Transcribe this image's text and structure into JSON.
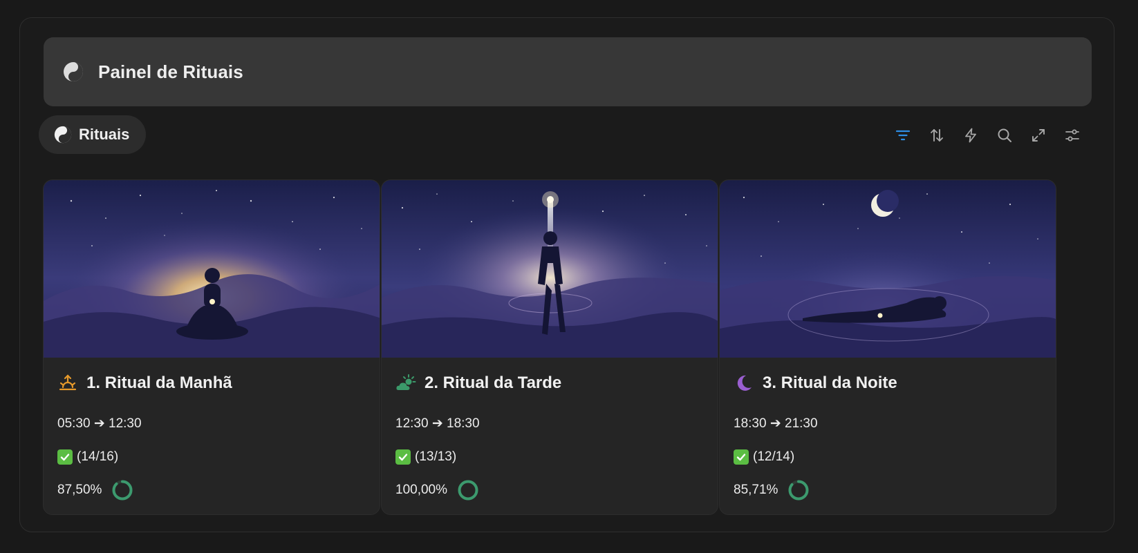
{
  "callout": {
    "icon": "yin-yang-icon",
    "title": "Painel de Rituais"
  },
  "view_tab": {
    "icon": "yin-yang-icon",
    "label": "Rituais"
  },
  "toolbar": {
    "items": [
      "filter-icon",
      "sort-icon",
      "automation-lightning-icon",
      "search-icon",
      "expand-icon",
      "settings-sliders-icon"
    ],
    "active_color": "#2e8ee6",
    "icon_color": "#a8a8a8"
  },
  "cards": [
    {
      "icon": "sunrise-icon",
      "icon_color": "#e79a2b",
      "title": "1. Ritual da Manhã",
      "time": "05:30 ➔ 12:30",
      "checked": "(14/16)",
      "percent": "87,50%",
      "progress": 0.875,
      "image": "meditating-figure-at-sunrise"
    },
    {
      "icon": "sun-behind-cloud-icon",
      "icon_color": "#3b9a6a",
      "title": "2. Ritual da Tarde",
      "time": "12:30 ➔ 18:30",
      "checked": "(13/13)",
      "percent": "100,00%",
      "progress": 1.0,
      "image": "walking-figure-under-star"
    },
    {
      "icon": "crescent-moon-icon",
      "icon_color": "#9a5fd0",
      "title": "3. Ritual da Noite",
      "time": "18:30 ➔ 21:30",
      "checked": "(12/14)",
      "percent": "85,71%",
      "progress": 0.8571,
      "image": "sleeping-figure-under-moon"
    }
  ],
  "colors": {
    "ring": "#3c9a6e",
    "ring_track": "#2f3d36",
    "checkbox": "#5bbd43"
  }
}
